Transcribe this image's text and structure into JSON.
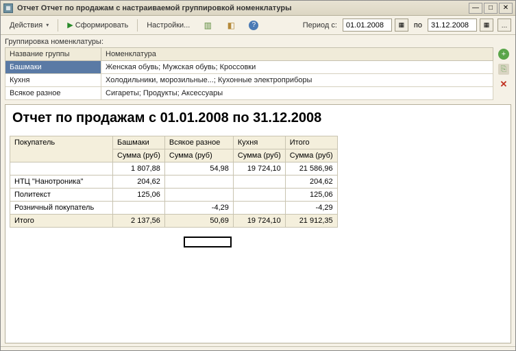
{
  "window": {
    "title": "Отчет  Отчет по продажам с настраиваемой группировкой номенклатуры"
  },
  "toolbar": {
    "actions_label": "Действия",
    "generate_label": "Сформировать",
    "settings_label": "Настройки...",
    "period_label": "Период с:",
    "period_sep": "по",
    "date_from": "01.01.2008",
    "date_to": "31.12.2008"
  },
  "grouping": {
    "label": "Группировка номенклатуры:",
    "col_group": "Название группы",
    "col_nom": "Номенклатура",
    "rows": [
      {
        "group": "Башмаки",
        "nom": "Женская обувь; Мужская обувь; Кроссовки"
      },
      {
        "group": "Кухня",
        "nom": "Холодильники, морозильные...; Кухонные электроприборы"
      },
      {
        "group": "Всякое разное",
        "nom": "Сигареты; Продукты; Аксессуары"
      }
    ]
  },
  "report": {
    "title": "Отчет по продажам с 01.01.2008 по 31.12.2008",
    "col_customer": "Покупатель",
    "subcol": "Сумма (руб)",
    "groups": [
      "Башмаки",
      "Всякое разное",
      "Кухня",
      "Итого"
    ],
    "rows": [
      {
        "label": "",
        "v": [
          "1 807,88",
          "54,98",
          "19 724,10",
          "21 586,96"
        ]
      },
      {
        "label": "НТЦ \"Нанотроника\"",
        "v": [
          "204,62",
          "",
          "",
          "204,62"
        ]
      },
      {
        "label": "Политекст",
        "v": [
          "125,06",
          "",
          "",
          "125,06"
        ]
      },
      {
        "label": "Розничный покупатель",
        "v": [
          "",
          "-4,29",
          "",
          "-4,29"
        ]
      }
    ],
    "total_label": "Итого",
    "totals": [
      "2 137,56",
      "50,69",
      "19 724,10",
      "21 912,35"
    ]
  },
  "chart_data": {
    "type": "table",
    "title": "Отчет по продажам с 01.01.2008 по 31.12.2008",
    "columns": [
      "Покупатель",
      "Башмаки Сумма (руб)",
      "Всякое разное Сумма (руб)",
      "Кухня Сумма (руб)",
      "Итого Сумма (руб)"
    ],
    "rows": [
      [
        "",
        1807.88,
        54.98,
        19724.1,
        21586.96
      ],
      [
        "НТЦ \"Нанотроника\"",
        204.62,
        null,
        null,
        204.62
      ],
      [
        "Политекст",
        125.06,
        null,
        null,
        125.06
      ],
      [
        "Розничный покупатель",
        null,
        -4.29,
        null,
        -4.29
      ],
      [
        "Итого",
        2137.56,
        50.69,
        19724.1,
        21912.35
      ]
    ]
  }
}
